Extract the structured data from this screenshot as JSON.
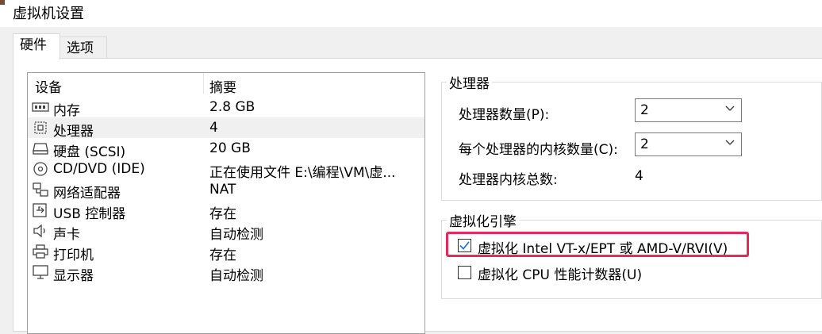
{
  "window": {
    "title": "虚拟机设置"
  },
  "tabs": [
    {
      "label": "硬件"
    },
    {
      "label": "选项"
    }
  ],
  "device_list": {
    "headers": {
      "device": "设备",
      "summary": "摘要"
    },
    "rows": [
      {
        "icon": "memory-icon",
        "name": "内存",
        "summary": "2.8 GB"
      },
      {
        "icon": "processor-icon",
        "name": "处理器",
        "summary": "4"
      },
      {
        "icon": "hard-disk-icon",
        "name": "硬盘 (SCSI)",
        "summary": "20 GB"
      },
      {
        "icon": "cd-dvd-icon",
        "name": "CD/DVD (IDE)",
        "summary": "正在使用文件 E:\\编程\\VM\\虚..."
      },
      {
        "icon": "network-adapter-icon",
        "name": "网络适配器",
        "summary": "NAT"
      },
      {
        "icon": "usb-icon",
        "name": "USB 控制器",
        "summary": "存在"
      },
      {
        "icon": "sound-card-icon",
        "name": "声卡",
        "summary": "自动检测"
      },
      {
        "icon": "printer-icon",
        "name": "打印机",
        "summary": "存在"
      },
      {
        "icon": "display-icon",
        "name": "显示器",
        "summary": "自动检测"
      }
    ]
  },
  "processor_group": {
    "legend": "处理器",
    "count_label": "处理器数量(P):",
    "count_value": "2",
    "cores_label": "每个处理器的内核数量(C):",
    "cores_value": "2",
    "total_label": "处理器内核总数:",
    "total_value": "4"
  },
  "virtualization_group": {
    "legend": "虚拟化引擎",
    "vtx_label": "虚拟化 Intel VT-x/EPT 或 AMD-V/RVI(V)",
    "vtx_checked": true,
    "cpu_counter_label": "虚拟化 CPU 性能计数器(U)",
    "cpu_counter_checked": false
  },
  "colors": {
    "highlight": "#e8285a",
    "selected_row": "#f0f0f0"
  }
}
